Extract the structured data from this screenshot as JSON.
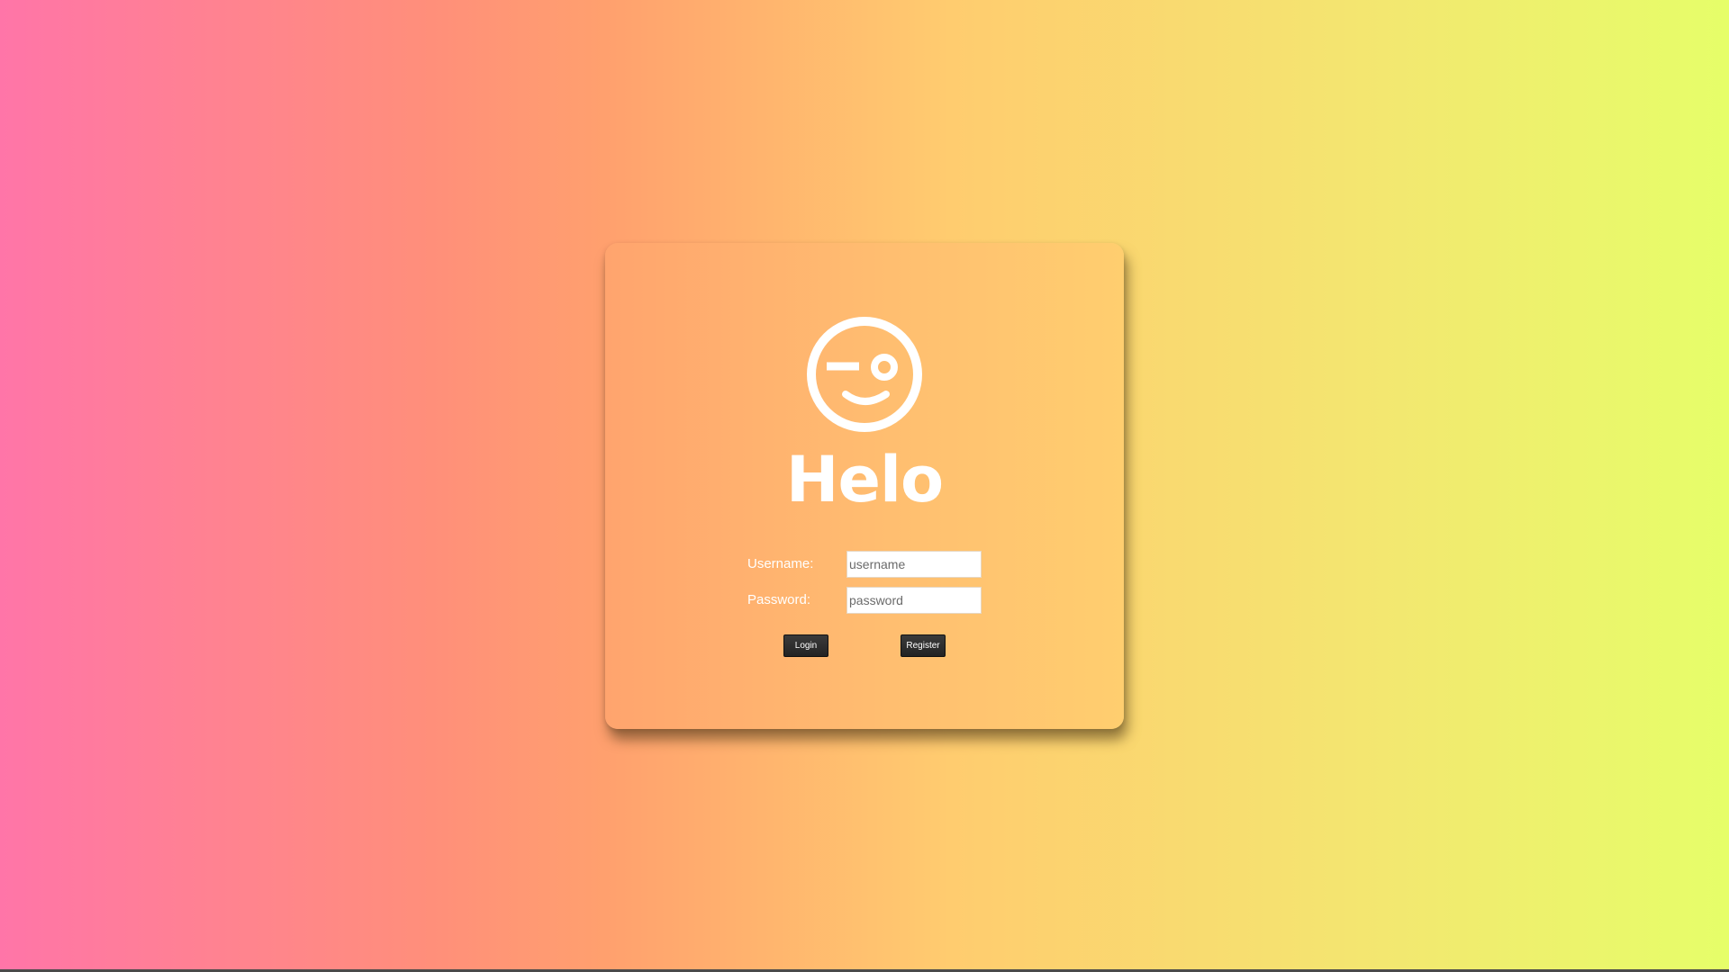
{
  "app": {
    "title": "Helo",
    "logo_icon": "wink-face-icon"
  },
  "form": {
    "username_label": "Username:",
    "username_placeholder": "username",
    "username_value": "",
    "password_label": "Password:",
    "password_placeholder": "password",
    "password_value": ""
  },
  "buttons": {
    "login_label": "Login",
    "register_label": "Register"
  },
  "colors": {
    "background_left": "#ff75a8",
    "background_right": "#e6fe69",
    "card": "#ffbe70",
    "button": "#2b2b2b",
    "text": "#ffffff"
  }
}
